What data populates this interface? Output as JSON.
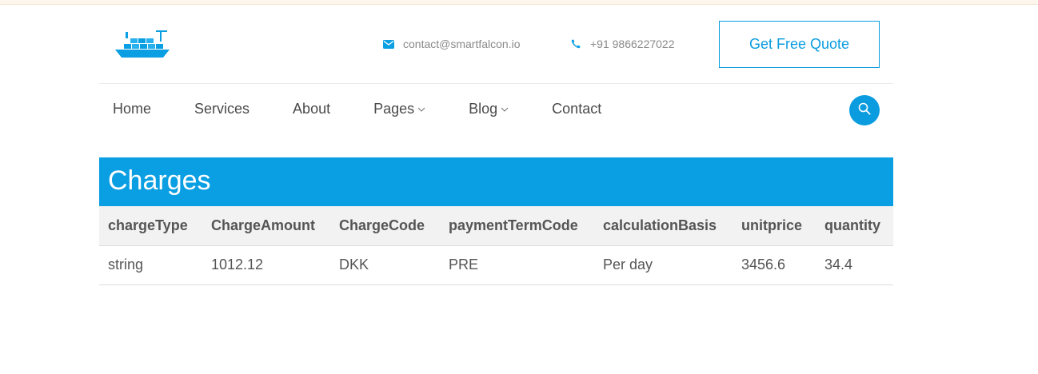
{
  "header": {
    "email": "contact@smartfalcon.io",
    "phone": "+91 9866227022",
    "quote_button": "Get Free Quote"
  },
  "nav": {
    "items": [
      "Home",
      "Services",
      "About",
      "Pages",
      "Blog",
      "Contact"
    ]
  },
  "charges": {
    "title": "Charges",
    "columns": [
      "chargeType",
      "ChargeAmount",
      "ChargeCode",
      "paymentTermCode",
      "calculationBasis",
      "unitprice",
      "quantity"
    ],
    "rows": [
      [
        "string",
        "1012.12",
        "DKK",
        "PRE",
        "Per day",
        "3456.6",
        "34.4"
      ]
    ]
  },
  "colors": {
    "brand": "#0a9fe2",
    "table_header_bg": "#f2f2f2",
    "text": "#555555"
  },
  "icons": [
    "ship-logo",
    "envelope-icon",
    "phone-icon",
    "chevron-down-icon",
    "search-icon"
  ]
}
